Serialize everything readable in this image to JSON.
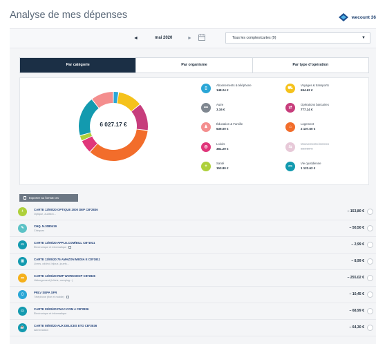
{
  "header": {
    "title": "Analyse de mes dépenses",
    "brand": "wecount 36"
  },
  "period": {
    "prev": "◄",
    "month": "mai 2020",
    "next": "►",
    "account_select": "Tous les comptes/cartes (9)"
  },
  "tabs": [
    {
      "label": "Par catégorie",
      "active": true
    },
    {
      "label": "Par organisme",
      "active": false
    },
    {
      "label": "Par type d'opération",
      "active": false
    }
  ],
  "summary": {
    "total": "6 027.17 €"
  },
  "chart_data": {
    "type": "pie",
    "categories": [
      "Abonnements & téléphone",
      "Voyages & transports",
      "Opérations bancaires",
      "Logement",
      "Loisirs",
      "Santé",
      "Vie quotidienne",
      "Éducation & Famille",
      "Autre"
    ],
    "values": [
      148.24,
      694.62,
      777.14,
      2107.6,
      381.29,
      153.8,
      1122.62,
      639.0,
      3.16
    ],
    "colors": [
      "#2aa6d6",
      "#f5c21b",
      "#c73d7c",
      "#f26d2b",
      "#e0367a",
      "#aed03b",
      "#139aaf",
      "#f48e8e",
      "#b8bec6"
    ]
  },
  "categories": [
    {
      "name": "Abonnements & téléphone",
      "amount": "148.24 €",
      "color": "#2aa6d6",
      "icon": "phone-icon",
      "glyph": "▯"
    },
    {
      "name": "Voyages & transports",
      "amount": "694.62 €",
      "color": "#f5c21b",
      "icon": "car-icon",
      "glyph": "⛟"
    },
    {
      "name": "Autre",
      "amount": "3.16 €",
      "color": "#7f8790",
      "icon": "more-icon",
      "glyph": "•••"
    },
    {
      "name": "Opérations bancaires",
      "amount": "777.14 €",
      "color": "#c73d7c",
      "icon": "transfer-icon",
      "glyph": "⇄"
    },
    {
      "name": "Éducation & Famille",
      "amount": "639.00 €",
      "color": "#f48e8e",
      "icon": "family-icon",
      "glyph": "♟"
    },
    {
      "name": "Logement",
      "amount": "2 107.60 €",
      "color": "#f26d2b",
      "icon": "home-icon",
      "glyph": "⌂"
    },
    {
      "name": "Loisirs",
      "amount": "381.29 €",
      "color": "#e0367a",
      "icon": "leisure-icon",
      "glyph": "◎"
    },
    {
      "name": "Mouvements internes",
      "amount": "624.00 €",
      "color": "#e7c9d8",
      "icon": "internal-transfer-icon",
      "glyph": "⇆"
    },
    {
      "name": "Santé",
      "amount": "153.80 €",
      "color": "#aed03b",
      "icon": "health-icon",
      "glyph": "+"
    },
    {
      "name": "Vie quotidienne",
      "amount": "1 122.62 €",
      "color": "#139aaf",
      "icon": "cart-icon",
      "glyph": "▭"
    }
  ],
  "export": {
    "label": "Exporter au format csv"
  },
  "transactions": [
    {
      "label": "CARTE 13/05/20 OPTIQUE 2000 DEP CB*2836",
      "sub": "Optique, audition...",
      "amount": "− 153,80 €",
      "color": "#aed03b",
      "icon": "health-icon",
      "glyph": "+",
      "note": false
    },
    {
      "label": "CHQ. N.3080419",
      "sub": "Chèques",
      "amount": "− 50,50 €",
      "color": "#5cc2c6",
      "icon": "check-icon",
      "glyph": "✎",
      "note": false
    },
    {
      "label": "CARTE 13/05/20 APPLE.COM/BILL CB*1911",
      "sub": "Électronique et informatique",
      "amount": "− 2,99 €",
      "color": "#139aaf",
      "icon": "computer-icon",
      "glyph": "▭",
      "note": true
    },
    {
      "label": "CARTE 13/05/20 75 AMAZON MEDIA E CB*1911",
      "sub": "Livres, cd/dvd, bijoux, jouets...",
      "amount": "− 8,99 €",
      "color": "#139aaf",
      "icon": "book-icon",
      "glyph": "▥",
      "note": false
    },
    {
      "label": "CARTE 13/05/20 RMP WORKSHOP CB*2836",
      "sub": "Hébergement (hôtels, camping...)",
      "amount": "− 255,02 €",
      "color": "#f5b01b",
      "icon": "hotel-icon",
      "glyph": "▬",
      "note": false
    },
    {
      "label": "PRLV SEPA SFR",
      "sub": "Téléphone (fixe et mobile)",
      "amount": "− 10,45 €",
      "color": "#2aa6d6",
      "icon": "phone-icon",
      "glyph": "▯",
      "note": true
    },
    {
      "label": "CARTE 09/05/20 FNAC.COM 4 CB*2836",
      "sub": "Électronique et informatique",
      "amount": "− 68,99 €",
      "color": "#139aaf",
      "icon": "computer-icon",
      "glyph": "▭",
      "note": false
    },
    {
      "label": "CARTE 08/05/20 AUX DELICES ETO CB*2836",
      "sub": "Alimentation",
      "amount": "− 64,30 €",
      "color": "#139aaf",
      "icon": "food-icon",
      "glyph": "☕",
      "note": false
    }
  ]
}
